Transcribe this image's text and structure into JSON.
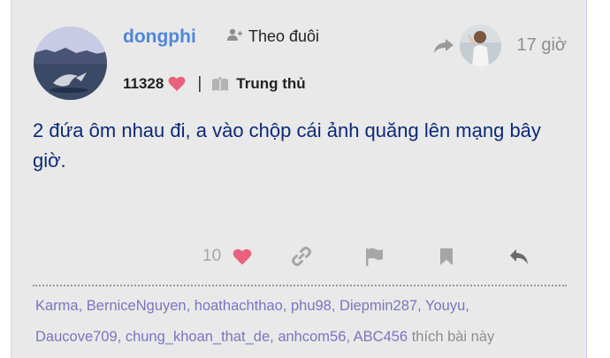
{
  "post": {
    "author": "dongphi",
    "follow_label": "Theo đuôi",
    "likes_total": "11328",
    "rank": "Trung thủ",
    "time": "17 giờ",
    "body": "2 đứa ôm nhau đi, a vào chộp cái ảnh quăng lên mạng bây giờ."
  },
  "actions": {
    "like_count": "10"
  },
  "liked_by": {
    "users": [
      "Karma",
      "BerniceNguyen",
      "hoathachthao",
      "phu98",
      "Diepmin287",
      "Youyu",
      "Daucove709",
      "chung_khoan_that_de",
      "anhcom56",
      "ABC456"
    ],
    "suffix": "thích bài này"
  },
  "colors": {
    "username": "#4f86d9",
    "body_text": "#0d2a78",
    "heart": "#e8627e",
    "liker_link": "#7c74c0",
    "muted": "#8e8e8e"
  },
  "icons": [
    "add-user-icon",
    "heart-icon",
    "book-icon",
    "share-arrow-icon",
    "link-icon",
    "flag-icon",
    "bookmark-icon",
    "reply-icon"
  ]
}
